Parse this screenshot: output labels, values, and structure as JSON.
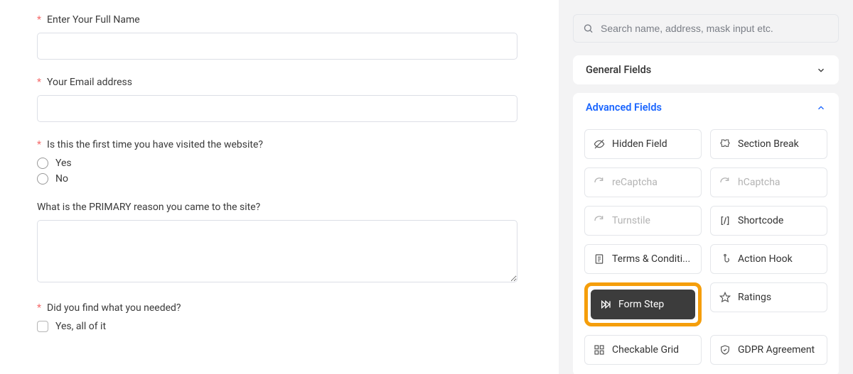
{
  "form": {
    "name": {
      "label": "Enter Your Full Name"
    },
    "email": {
      "label": "Your Email address"
    },
    "firstVisit": {
      "label": "Is this the first time you have visited the website?",
      "options": [
        "Yes",
        "No"
      ]
    },
    "reason": {
      "label": "What is the PRIMARY reason you came to the site?"
    },
    "found": {
      "label": "Did you find what you needed?",
      "options": [
        "Yes, all of it"
      ]
    }
  },
  "sidebar": {
    "search": {
      "placeholder": "Search name, address, mask input etc."
    },
    "general": {
      "title": "General Fields"
    },
    "advanced": {
      "title": "Advanced Fields",
      "tiles": {
        "hidden": "Hidden Field",
        "section": "Section Break",
        "recaptcha": "reCaptcha",
        "hcaptcha": "hCaptcha",
        "turnstile": "Turnstile",
        "shortcode": "Shortcode",
        "terms": "Terms & Conditi...",
        "action": "Action Hook",
        "formstep": "Form Step",
        "ratings": "Ratings",
        "checkable": "Checkable Grid",
        "gdpr": "GDPR Agreement"
      }
    }
  }
}
